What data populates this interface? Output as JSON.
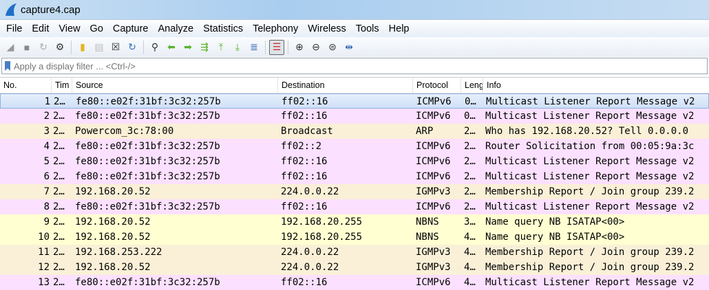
{
  "window": {
    "title": "capture4.cap"
  },
  "menu": [
    "File",
    "Edit",
    "View",
    "Go",
    "Capture",
    "Analyze",
    "Statistics",
    "Telephony",
    "Wireless",
    "Tools",
    "Help"
  ],
  "toolbar": [
    "start-capture",
    "stop-capture",
    "restart-capture",
    "capture-options",
    "open-file",
    "save-file",
    "close-file",
    "reload-file",
    "find-packet",
    "go-back",
    "go-forward",
    "go-to-packet",
    "go-first",
    "go-last",
    "auto-scroll",
    "colorize",
    "zoom-in",
    "zoom-out",
    "zoom-normal",
    "resize-columns"
  ],
  "filter": {
    "placeholder": "Apply a display filter ... <Ctrl-/>"
  },
  "columns": [
    "No.",
    "Tim",
    "Source",
    "Destination",
    "Protocol",
    "Leng",
    "Info"
  ],
  "colors": {
    "icmpv6": "#fce0ff",
    "arp_igmp": "#faf0d7",
    "nbns": "#ffffd2"
  },
  "packets": [
    {
      "no": "1",
      "time": "2…",
      "src": "fe80::e02f:31bf:3c32:257b",
      "dst": "ff02::16",
      "proto": "ICMPv6",
      "len": "0…",
      "info": "Multicast Listener Report Message v2",
      "color": "#fce0ff",
      "selected": true
    },
    {
      "no": "2",
      "time": "2…",
      "src": "fe80::e02f:31bf:3c32:257b",
      "dst": "ff02::16",
      "proto": "ICMPv6",
      "len": "0…",
      "info": "Multicast Listener Report Message v2",
      "color": "#fce0ff"
    },
    {
      "no": "3",
      "time": "2…",
      "src": "Powercom_3c:78:00",
      "dst": "Broadcast",
      "proto": "ARP",
      "len": "2…",
      "info": "Who has 192.168.20.52? Tell 0.0.0.0",
      "color": "#faf0d7"
    },
    {
      "no": "4",
      "time": "2…",
      "src": "fe80::e02f:31bf:3c32:257b",
      "dst": "ff02::2",
      "proto": "ICMPv6",
      "len": "2…",
      "info": "Router Solicitation from 00:05:9a:3c",
      "color": "#fce0ff"
    },
    {
      "no": "5",
      "time": "2…",
      "src": "fe80::e02f:31bf:3c32:257b",
      "dst": "ff02::16",
      "proto": "ICMPv6",
      "len": "2…",
      "info": "Multicast Listener Report Message v2",
      "color": "#fce0ff"
    },
    {
      "no": "6",
      "time": "2…",
      "src": "fe80::e02f:31bf:3c32:257b",
      "dst": "ff02::16",
      "proto": "ICMPv6",
      "len": "2…",
      "info": "Multicast Listener Report Message v2",
      "color": "#fce0ff"
    },
    {
      "no": "7",
      "time": "2…",
      "src": "192.168.20.52",
      "dst": "224.0.0.22",
      "proto": "IGMPv3",
      "len": "2…",
      "info": "Membership Report / Join group 239.2",
      "color": "#faf0d7"
    },
    {
      "no": "8",
      "time": "2…",
      "src": "fe80::e02f:31bf:3c32:257b",
      "dst": "ff02::16",
      "proto": "ICMPv6",
      "len": "2…",
      "info": "Multicast Listener Report Message v2",
      "color": "#fce0ff"
    },
    {
      "no": "9",
      "time": "2…",
      "src": "192.168.20.52",
      "dst": "192.168.20.255",
      "proto": "NBNS",
      "len": "3…",
      "info": "Name query NB ISATAP<00>",
      "color": "#ffffd2"
    },
    {
      "no": "10",
      "time": "2…",
      "src": "192.168.20.52",
      "dst": "192.168.20.255",
      "proto": "NBNS",
      "len": "4…",
      "info": "Name query NB ISATAP<00>",
      "color": "#ffffd2"
    },
    {
      "no": "11",
      "time": "2…",
      "src": "192.168.253.222",
      "dst": "224.0.0.22",
      "proto": "IGMPv3",
      "len": "4…",
      "info": "Membership Report / Join group 239.2",
      "color": "#faf0d7"
    },
    {
      "no": "12",
      "time": "2…",
      "src": "192.168.20.52",
      "dst": "224.0.0.22",
      "proto": "IGMPv3",
      "len": "4…",
      "info": "Membership Report / Join group 239.2",
      "color": "#faf0d7"
    },
    {
      "no": "13",
      "time": "2…",
      "src": "fe80::e02f:31bf:3c32:257b",
      "dst": "ff02::16",
      "proto": "ICMPv6",
      "len": "4…",
      "info": "Multicast Listener Report Message v2",
      "color": "#fce0ff"
    }
  ]
}
